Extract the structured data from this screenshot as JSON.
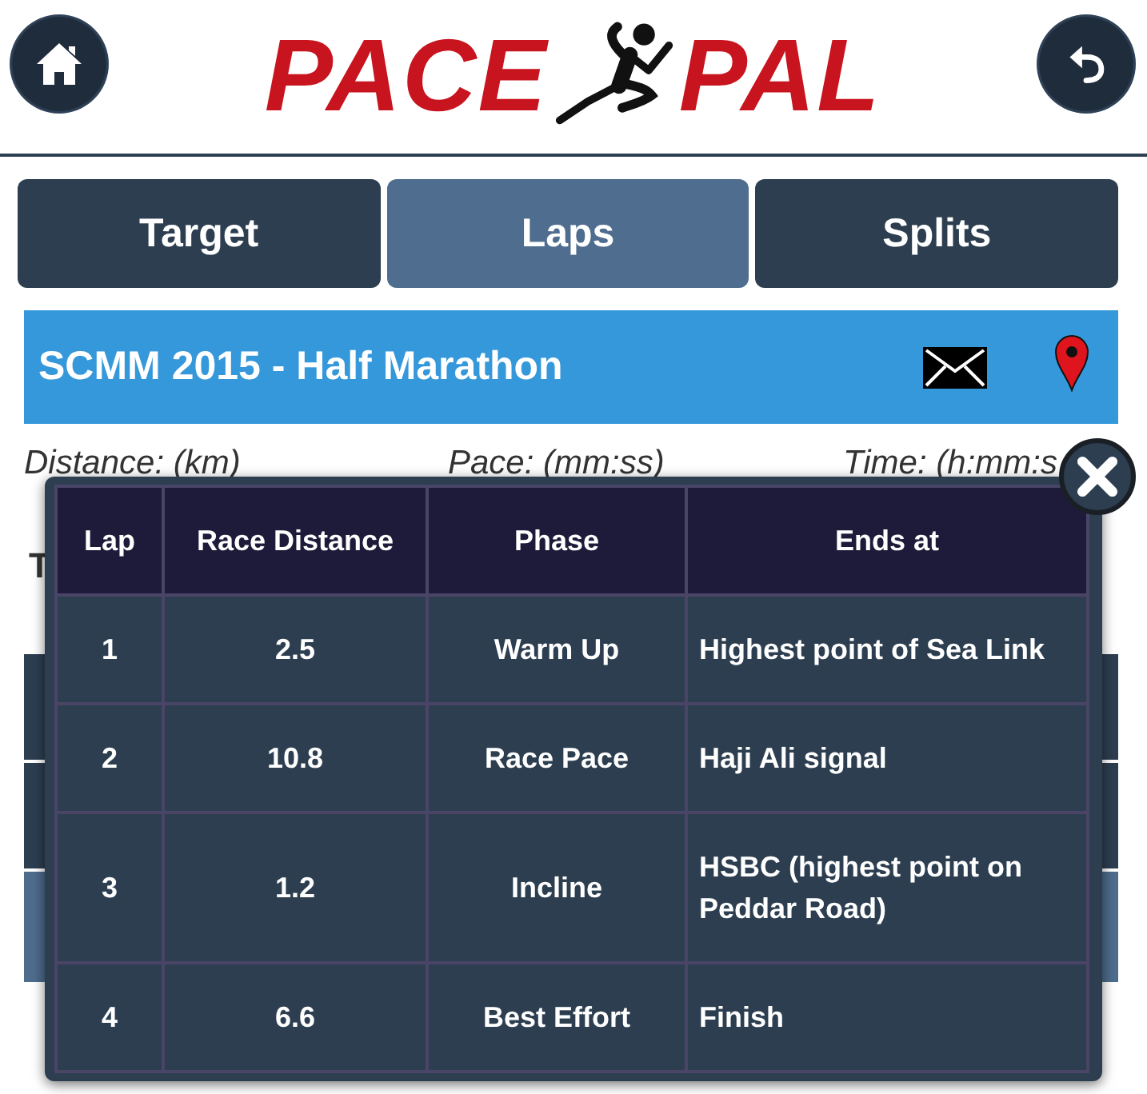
{
  "header": {
    "logo": [
      "PACE",
      "PAL"
    ]
  },
  "tabs": [
    {
      "label": "Target",
      "selected": false
    },
    {
      "label": "Laps",
      "selected": true
    },
    {
      "label": "Splits",
      "selected": false
    }
  ],
  "race_bar": {
    "title": "SCMM 2015 - Half Marathon"
  },
  "field_labels": [
    "Distance: (km)",
    "Pace: (mm:ss)",
    "Time: (h:mm:s"
  ],
  "covered_label": "T",
  "laps_dialog": {
    "columns": [
      "Lap",
      "Race Distance",
      "Phase",
      "Ends at"
    ],
    "rows": [
      [
        "1",
        "2.5",
        "Warm Up",
        "Highest point of Sea Link"
      ],
      [
        "2",
        "10.8",
        "Race Pace",
        "Haji Ali signal"
      ],
      [
        "3",
        "1.2",
        "Incline",
        "HSBC (highest point on Peddar Road)"
      ],
      [
        "4",
        "6.6",
        "Best Effort",
        "Finish"
      ]
    ]
  }
}
